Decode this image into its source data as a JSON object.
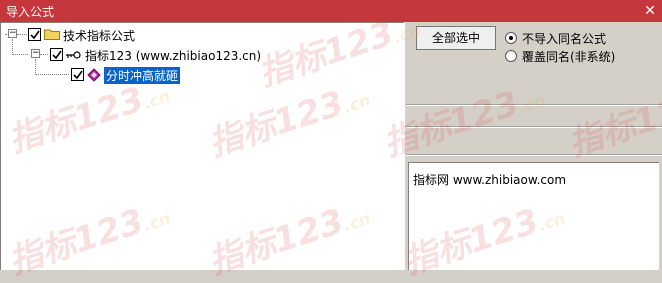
{
  "window": {
    "title": "导入公式",
    "close_label": "✕"
  },
  "tree": {
    "root": {
      "label": "技术指标公式",
      "checked": true,
      "expander": "−"
    },
    "group": {
      "label": "指标123  (www.zhibiao123.cn)",
      "checked": true,
      "expander": "−"
    },
    "item": {
      "label": "分时冲高就砸",
      "checked": true,
      "selected": true
    }
  },
  "actions": {
    "select_all_label": "全部选中"
  },
  "options": {
    "no_import_same_name": {
      "label": "不导入同名公式",
      "selected": true
    },
    "overwrite_same_name": {
      "label": "覆盖同名(非系统)",
      "selected": false
    }
  },
  "info": {
    "text": "指标网 www.zhibiaow.com"
  },
  "watermark": {
    "text": "指标123",
    "suffix": ".cn"
  },
  "colors": {
    "titlebar": "#c5373d",
    "selection": "#0a64c8",
    "folder": "#f3d35d"
  }
}
